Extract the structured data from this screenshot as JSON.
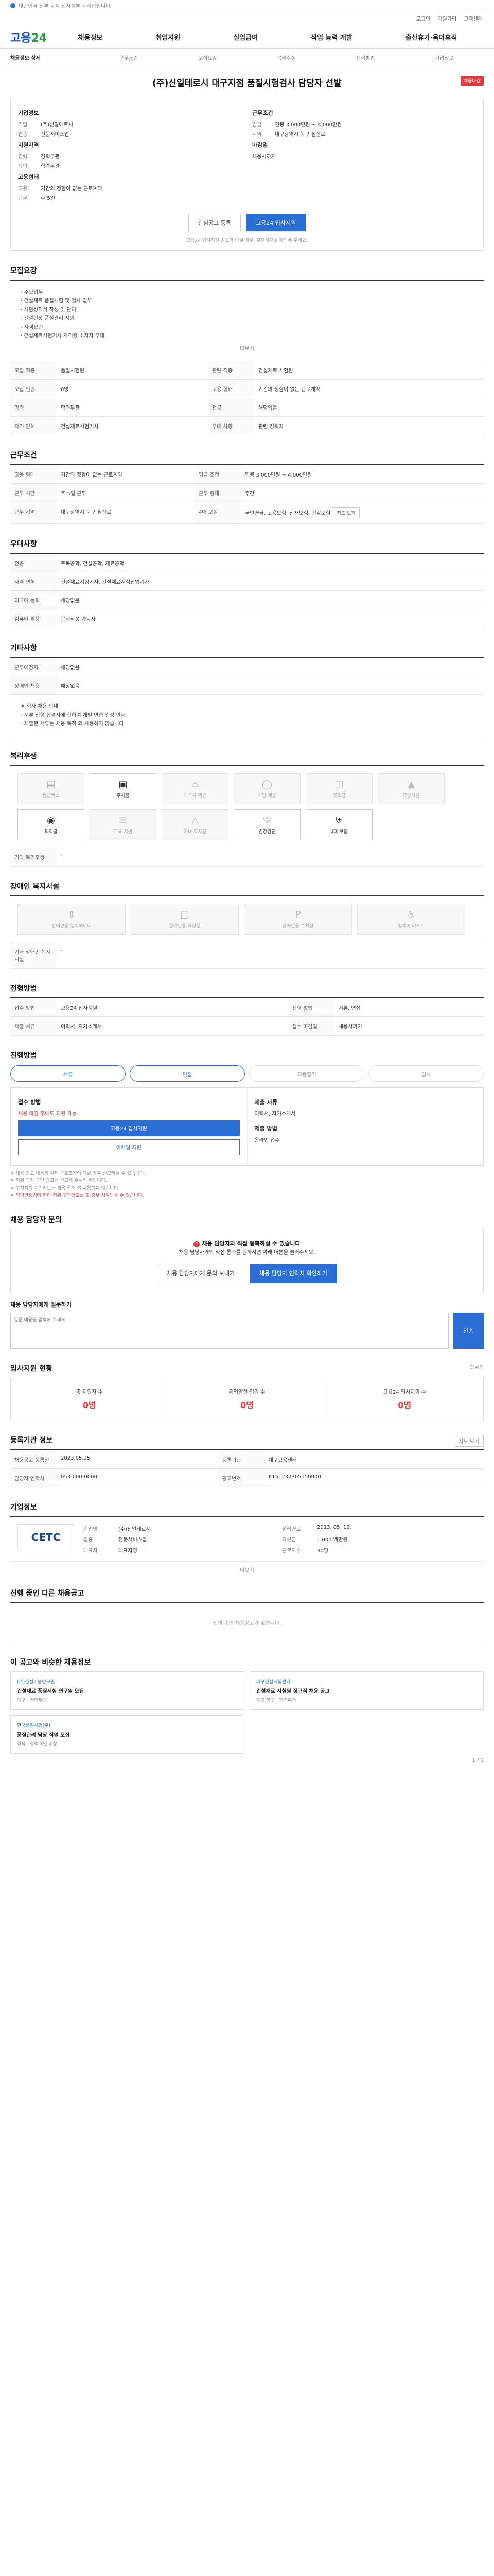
{
  "topbar": {
    "notice": "대한민국 정부 공식 전자정부 누리집입니다."
  },
  "util": [
    "로그인",
    "회원가입",
    "고객센터"
  ],
  "site": {
    "logo_main": "고용",
    "logo_sub": "24"
  },
  "gnb": [
    "채용정보",
    "취업지원",
    "실업급여",
    "직업 능력 개발",
    "출산휴가·육아휴직"
  ],
  "subnav": [
    "채용정보 상세",
    "근무조건",
    "모집요강",
    "복리후생",
    "전형방법",
    "기업정보"
  ],
  "job": {
    "title": "(주)신일테로시 대구지점 품질시험검사 담당자 선발",
    "badge": "채용마감",
    "company_label": "기업정보",
    "company_rows": [
      {
        "k": "기업",
        "v": "(주)신일테로시"
      },
      {
        "k": "업종",
        "v": "전문서비스업"
      }
    ],
    "cond_label": "근무조건",
    "cond_rows": [
      {
        "k": "임금",
        "v": "연봉 3,000만원 ~ 4,000만원"
      },
      {
        "k": "지역",
        "v": "대구광역시 북구 침산로"
      }
    ],
    "req_label": "지원자격",
    "req_rows": [
      {
        "k": "경력",
        "v": "경력무관"
      },
      {
        "k": "학력",
        "v": "학력무관"
      }
    ],
    "form_label": "고용형태",
    "form_rows": [
      {
        "k": "고용",
        "v": "기간의 정함이 없는 근로계약"
      },
      {
        "k": "근무",
        "v": "주 5일"
      }
    ],
    "deadline_label": "마감일",
    "deadline": "채용시까지",
    "btn_scrap": "관심공고 등록",
    "btn_apply": "고용24 입사지원",
    "note": "고용24 입사지원 공고가 아닐 경우, 홈페이지를 확인해 주세요."
  },
  "recruit": {
    "title": "모집요강",
    "desc": [
      "- 주요업무",
      "· 건설재료 품질시험 및 검사 업무",
      "· 시험성적서 작성 및 관리",
      "· 건설현장 품질관리 지원",
      "- 자격요건",
      "· 건설재료시험기사 자격증 소지자 우대"
    ],
    "more": "더보기",
    "rows": [
      {
        "k": "모집 직종",
        "v": "품질시험원",
        "k2": "관련 직종",
        "v2": "건설재료 시험원"
      },
      {
        "k": "모집 인원",
        "v": "0명",
        "k2": "고용 형태",
        "v2": "기간의 정함이 없는 근로계약"
      },
      {
        "k": "학력",
        "v": "학력무관",
        "k2": "전공",
        "v2": "해당없음"
      },
      {
        "k": "자격 면허",
        "v": "건설재료시험기사",
        "k2": "우대 사항",
        "v2": "관련 경력자"
      }
    ]
  },
  "work": {
    "title": "근무조건",
    "rows": [
      {
        "k": "고용 형태",
        "v": "기간의 정함이 없는 근로계약",
        "k2": "임금 조건",
        "v2": "연봉 3,000만원 ~ 4,000만원"
      },
      {
        "k": "근무 시간",
        "v": "주 5일 근무",
        "k2": "근무 형태",
        "v2": "주간"
      },
      {
        "k": "근무 지역",
        "v": "대구광역시 북구 침산로",
        "k2": "4대 보험",
        "v2": "국민연금, 고용보험, 산재보험, 건강보험"
      }
    ],
    "map_btn": "지도 보기"
  },
  "apply_cond": {
    "title": "우대사항",
    "rows": [
      {
        "k": "전공",
        "v": "토목공학, 건설공학, 재료공학"
      },
      {
        "k": "자격 면허",
        "v": "건설재료시험기사, 건설재료시험산업기사"
      },
      {
        "k": "외국어 능력",
        "v": "해당없음"
      },
      {
        "k": "컴퓨터 활용",
        "v": "문서작성 가능자"
      }
    ]
  },
  "etc": {
    "title": "기타사항",
    "rows": [
      {
        "k": "근무예정지",
        "v": "해당없음"
      },
      {
        "k": "장애인 채용",
        "v": "해당없음"
      }
    ],
    "desc": [
      "※ 회사 채용 안내",
      "- 서류 전형 합격자에 한하여 개별 면접 일정 안내",
      "- 제출된 서류는 채용 목적 외 사용하지 않습니다."
    ]
  },
  "welfare": {
    "title": "복리후생",
    "items": [
      {
        "label": "통근버스",
        "icon": "bus-icon",
        "on": false
      },
      {
        "label": "주차장",
        "icon": "car-icon",
        "on": true
      },
      {
        "label": "기숙사 제공",
        "icon": "house-icon",
        "on": false
      },
      {
        "label": "식당 제공",
        "icon": "meal-icon",
        "on": false
      },
      {
        "label": "경조금",
        "icon": "gift-icon",
        "on": false
      },
      {
        "label": "휴양시설",
        "icon": "resort-icon",
        "on": false
      },
      {
        "label": "퇴직금",
        "icon": "coin-icon",
        "on": true
      },
      {
        "label": "교육 지원",
        "icon": "book-icon",
        "on": false
      },
      {
        "label": "자녀 학자금",
        "icon": "cap-icon",
        "on": false
      },
      {
        "label": "건강검진",
        "icon": "heart-icon",
        "on": true
      },
      {
        "label": "4대 보험",
        "icon": "shield-icon",
        "on": true
      }
    ],
    "etc_label": "기타 복리후생",
    "etc_value": "-"
  },
  "disability": {
    "title": "장애인 복지시설",
    "items": [
      {
        "label": "장애인용 엘리베이터",
        "icon": "elevator-icon"
      },
      {
        "label": "장애인용 화장실",
        "icon": "toilet-icon"
      },
      {
        "label": "장애인용 주차장",
        "icon": "parking-icon"
      },
      {
        "label": "휠체어 리프트",
        "icon": "wheelchair-icon"
      }
    ],
    "etc_label": "기타 장애인 복지시설",
    "etc_value": "-"
  },
  "screening": {
    "title": "전형방법",
    "rows": [
      {
        "k": "접수 방법",
        "v": "고용24 입사지원",
        "k2": "전형 방법",
        "v2": "서류, 면접"
      },
      {
        "k": "제출 서류",
        "v": "이력서, 자기소개서",
        "k2": "접수 마감일",
        "v2": "채용시까지"
      }
    ]
  },
  "progress": {
    "title": "진행방법",
    "steps": [
      "서류",
      "면접",
      "최종합격",
      "입사"
    ]
  },
  "applyinfo": {
    "title": "접수방법",
    "c1_title": "접수 방법",
    "c1_text": "채용 마감 후에도 지원 가능",
    "c1_btn1": "고용24 입사지원",
    "c1_btn2": "이메일 지원",
    "c2_title": "제출 서류",
    "c2_text": "이력서, 자기소개서",
    "c3_title": "제출 방법",
    "c3_text": "온라인 접수"
  },
  "fine": [
    "※ 채용 공고 내용과 실제 근로조건이 다를 경우 신고하실 수 있습니다.",
    "※ 허위·과장 구인 광고는 신고해 주시기 바랍니다.",
    "※ 구직자의 개인정보는 채용 목적 외 사용되지 않습니다."
  ],
  "fine_red": "※ 직업안정법에 따라 허위 구인광고를 할 경우 처벌받을 수 있습니다.",
  "inquiry": {
    "title": "채용 담당자 문의",
    "alert_head": "채용 담당자와 직접 통화하실 수 있습니다",
    "alert_text": "채용 담당자와의 직접 통화를 원하시면 아래 버튼을 눌러주세요.",
    "btn_a": "채용 담당자에게 문의 보내기",
    "btn_b": "채용 담당자 연락처 확인하기",
    "box_title": "채용 담당자에게 질문하기",
    "placeholder": "질문 내용을 입력해 주세요.",
    "send": "전송"
  },
  "stats": {
    "title": "입사지원 현황",
    "more": "더보기",
    "items": [
      {
        "label": "총 지원자 수",
        "n": "0명"
      },
      {
        "label": "취업알선 인원 수",
        "n": "0명"
      },
      {
        "label": "고용24 입사지원 수",
        "n": "0명"
      }
    ]
  },
  "regist": {
    "title": "등록기관 정보",
    "map_btn": "지도 보기",
    "rows": [
      {
        "k": "채용공고 등록일",
        "v": "2023.05.15",
        "k2": "등록기관",
        "v2": "대구고용센터"
      },
      {
        "k": "담당자 연락처",
        "v": "053-000-0000",
        "k2": "공고번호",
        "v2": "K151232305150000"
      }
    ]
  },
  "companyinfo": {
    "title": "기업정보",
    "logo": "CETC",
    "rows": [
      {
        "k": "기업명",
        "v": "(주)신일테로시"
      },
      {
        "k": "설립연도",
        "v": "2013. 05. 12."
      },
      {
        "k": "업종",
        "v": "전문서비스업"
      },
      {
        "k": "자본금",
        "v": "1,000 백만원"
      },
      {
        "k": "대표자",
        "v": "대표자명"
      },
      {
        "k": "근로자수",
        "v": "30명"
      }
    ],
    "more": "더보기"
  },
  "other_jobs": {
    "title": "진행 중인 다른 채용공고",
    "empty": "진행 중인 채용공고가 없습니다."
  },
  "recommend": {
    "title": "이 공고와 비슷한 채용정보",
    "items": [
      {
        "co": "(주)건설기술연구원",
        "title": "건설재료 품질시험 연구원 모집",
        "meta": "대구 · 경력무관"
      },
      {
        "co": "대구건설시험센터",
        "title": "건설재료 시험원 정규직 채용 공고",
        "meta": "대구 북구 · 학력무관"
      },
      {
        "co": "한국품질시험(주)",
        "title": "품질관리 담당 직원 모집",
        "meta": "경북 · 경력 1년 이상"
      }
    ],
    "pager": "1 / 1"
  }
}
